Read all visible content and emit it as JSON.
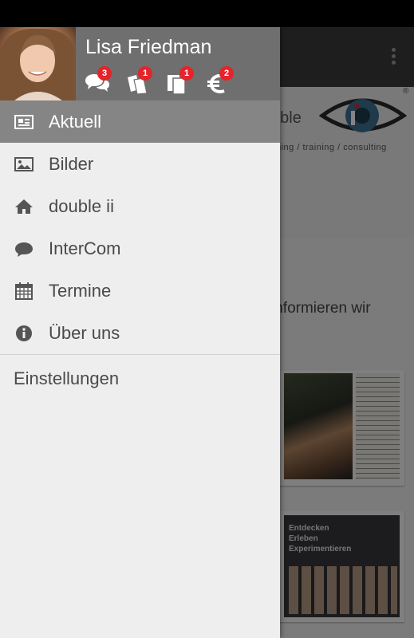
{
  "user": {
    "name": "Lisa Friedman"
  },
  "notifications": [
    {
      "icon": "chat-bubbles-icon",
      "count": "3"
    },
    {
      "icon": "tickets-icon",
      "count": "1"
    },
    {
      "icon": "documents-icon",
      "count": "1"
    },
    {
      "icon": "euro-icon",
      "count": "2"
    }
  ],
  "menu": {
    "items": [
      {
        "label": "Aktuell",
        "icon": "newspaper-icon",
        "active": true
      },
      {
        "label": "Bilder",
        "icon": "image-icon"
      },
      {
        "label": "double ii",
        "icon": "home-icon"
      },
      {
        "label": "InterCom",
        "icon": "speech-bubble-icon"
      },
      {
        "label": "Termine",
        "icon": "calendar-icon"
      },
      {
        "label": "Über uns",
        "icon": "info-icon"
      }
    ],
    "settings_label": "Einstellungen"
  },
  "background": {
    "logo_word": "uble",
    "tagline": "ching / training / consulting",
    "registered": "®",
    "info_text": "informieren wir",
    "info_dot": ".",
    "card2_title": "Entdecken\nErleben\nExperimentieren"
  },
  "colors": {
    "header_bg": "#6f6f6f",
    "active_item_bg": "#858585",
    "badge": "#e5232a",
    "drawer_bg": "#eeeeee"
  }
}
